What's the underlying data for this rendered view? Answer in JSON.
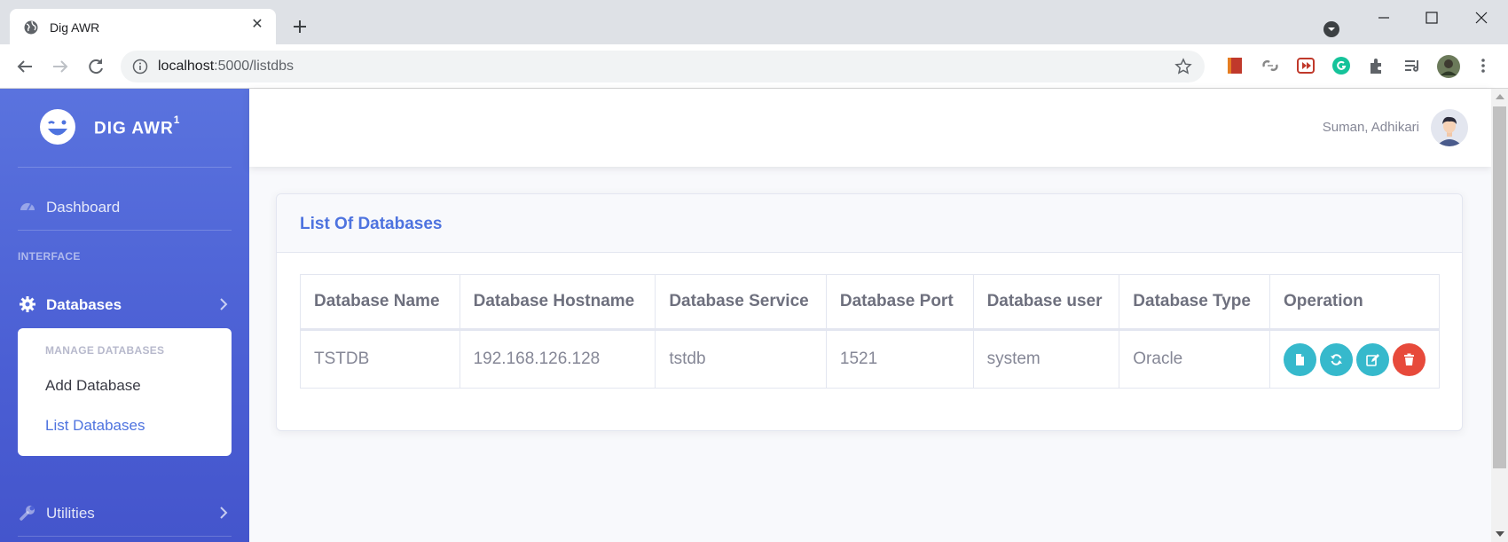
{
  "browser": {
    "tab_title": "Dig AWR",
    "tab_close": "✕",
    "url_host": "localhost",
    "url_rest": ":5000/listdbs"
  },
  "sidebar": {
    "brand_name": "DIG AWR",
    "brand_sup": "1",
    "dashboard_label": "Dashboard",
    "interface_heading": "INTERFACE",
    "databases_label": "Databases",
    "submenu": {
      "heading": "MANAGE DATABASES",
      "items": [
        "Add Database",
        "List Databases"
      ]
    },
    "utilities_label": "Utilities"
  },
  "topbar": {
    "username": "Suman, Adhikari"
  },
  "card": {
    "title": "List Of Databases"
  },
  "table": {
    "headers": [
      "Database Name",
      "Database Hostname",
      "Database Service",
      "Database Port",
      "Database user",
      "Database Type",
      "Operation"
    ],
    "rows": [
      [
        "TSTDB",
        "192.168.126.128",
        "tstdb",
        "1521",
        "system",
        "Oracle"
      ]
    ],
    "operations": [
      "view-icon",
      "refresh-icon",
      "edit-icon",
      "delete-icon"
    ]
  },
  "colors": {
    "primary": "#4e73df",
    "info": "#36b9cc",
    "danger": "#e74a3b"
  }
}
